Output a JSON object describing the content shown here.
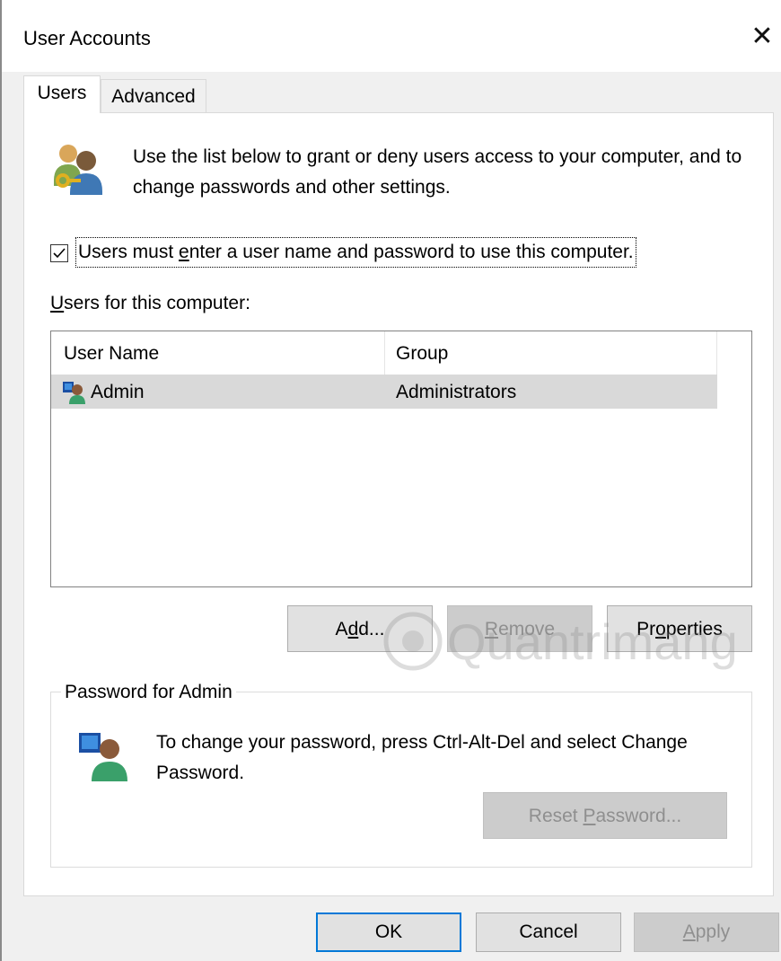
{
  "window": {
    "title": "User Accounts",
    "close_icon": "close-icon"
  },
  "tabs": [
    {
      "label": "Users",
      "active": true
    },
    {
      "label": "Advanced",
      "active": false
    }
  ],
  "intro": {
    "icon": "users-keys-icon",
    "text": "Use the list below to grant or deny users access to your computer, and to change passwords and other settings."
  },
  "require_login": {
    "checked": true,
    "label_pre": "Users must ",
    "label_accel": "e",
    "label_post": "nter a user name and password to use this computer."
  },
  "users_list": {
    "label_accel": "U",
    "label_rest": "sers for this computer:",
    "columns": [
      "User Name",
      "Group"
    ],
    "rows": [
      {
        "icon": "user-icon",
        "name": "Admin",
        "group": "Administrators",
        "selected": true
      }
    ]
  },
  "buttons": {
    "add": {
      "pre": "A",
      "accel": "d",
      "post": "d...",
      "enabled": true
    },
    "remove": {
      "accel": "R",
      "post": "emove",
      "enabled": false
    },
    "properties": {
      "pre": "Pr",
      "accel": "o",
      "post": "perties",
      "enabled": true
    }
  },
  "password_group": {
    "title": "Password for Admin",
    "icon": "user-password-icon",
    "text": "To change your password, press Ctrl-Alt-Del and select Change Password.",
    "reset": {
      "pre": "Reset ",
      "accel": "P",
      "post": "assword...",
      "enabled": false
    }
  },
  "footer": {
    "ok": "OK",
    "cancel": "Cancel",
    "apply": {
      "accel": "A",
      "post": "pply",
      "enabled": false
    }
  },
  "watermark": {
    "text": "Quantrimang"
  },
  "colors": {
    "accent": "#0078d7",
    "selection": "#d9d9d9",
    "disabled_text": "#8f8f8f"
  }
}
